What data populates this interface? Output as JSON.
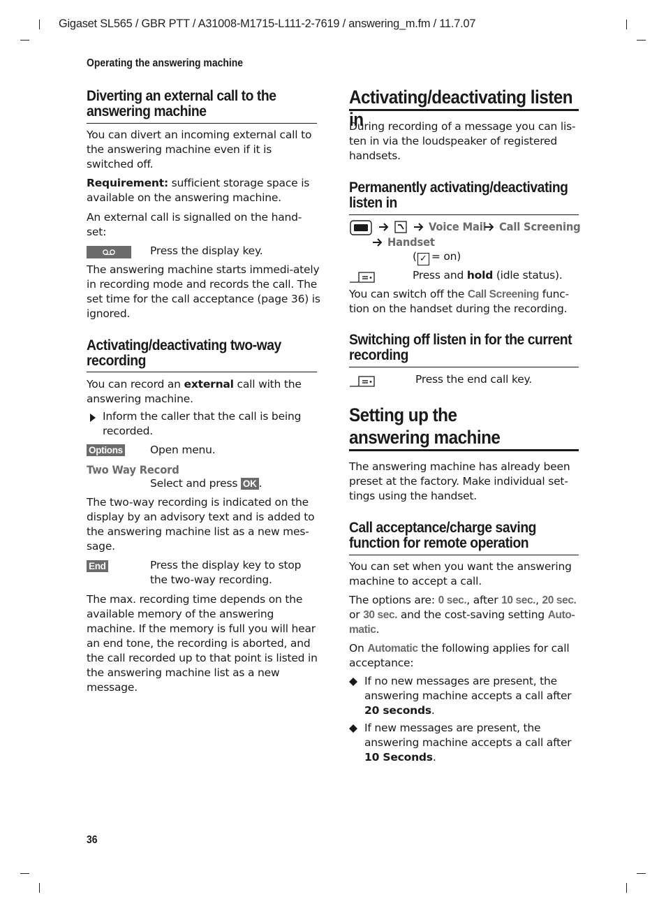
{
  "header": {
    "doc_line": "Gigaset SL565 / GBR PTT / A31008-M1715-L111-2-7619 / answering_m.fm / 11.7.07",
    "running_head": "Operating the answering machine",
    "page_number": "36"
  },
  "left": {
    "divert": {
      "title": "Diverting an external call to the answering machine",
      "intro": "You can divert an incoming external call to the answering machine even if it is switched off.",
      "req_label": "Requirement:",
      "req_text": " sufficient storage space is available on the answering machine.",
      "signalled": "An external call is signalled on the hand-set:",
      "step_icon": "voicemail-key-icon",
      "step_text": "Press the display key.",
      "after": "The answering machine starts immedi-ately in recording mode and records the call. The set time for the call acceptance (page 36) is ignored."
    },
    "twoway": {
      "title": "Activating/deactivating two-way recording",
      "intro_a": "You can record an ",
      "intro_b": "external",
      "intro_c": " call with the answering machine.",
      "bullet": "Inform the caller that the call is being recorded.",
      "options_key": "Options",
      "options_text": "Open menu.",
      "menu_item": "Two Way Record",
      "select_text": "Select and press ",
      "ok_key": "OK",
      "select_end": ".",
      "indicated": "The two-way recording is indicated on the display by an advisory text and is added to the answering machine list as a new mes-sage.",
      "end_key": "End",
      "end_text": "Press the display key to stop the two-way recording.",
      "max": "The max. recording time depends on the available memory of the answering machine. If the memory is full you will hear an end tone, the recording is aborted, and the call recorded up to that point is listed in the answering machine list as a new message."
    }
  },
  "right": {
    "listen": {
      "title": "Activating/deactivating listen in",
      "intro": "During recording of a message you can lis-ten in via the loudspeaker of registered handsets."
    },
    "permanent": {
      "title": "Permanently activating/deactivating listen in",
      "path": [
        "Voice Mail",
        "Call Screening",
        "Handset"
      ],
      "check_text": "= on)",
      "hold_a": "Press and ",
      "hold_b": "hold",
      "hold_c": " (idle status).",
      "switch_a": "You can switch off the ",
      "switch_ui": "Call Screening",
      "switch_b": " func-tion on the handset during the recording."
    },
    "switchoff": {
      "title": "Switching off listen in for the current recording",
      "step_text": "Press the end call key."
    },
    "setup": {
      "title": "Setting up the answering machine",
      "intro": "The answering machine has already been preset at the factory. Make individual set-tings using the handset."
    },
    "acceptance": {
      "title": "Call acceptance/charge saving function for remote operation",
      "intro": "You can set when you want the answering machine to accept a call.",
      "options_a": "The options are: ",
      "opt0": "0 sec.",
      "options_b": ", after ",
      "opt10": "10 sec.",
      "comma": ", ",
      "opt20": "20 sec.",
      "or": " or ",
      "opt30": "30 sec.",
      "options_c": " and the cost-saving setting ",
      "auto": "Auto-matic",
      "period": ".",
      "on_a": "On ",
      "on_auto": "Automatic",
      "on_b": " the following applies for call acceptance:",
      "bullets": [
        {
          "text": "If no new messages are present, the answering machine accepts a call after ",
          "bold": "20 seconds",
          "end": "."
        },
        {
          "text": "If new messages are present, the answering machine accepts a call after ",
          "bold": "10 Seconds",
          "end": "."
        }
      ]
    }
  }
}
